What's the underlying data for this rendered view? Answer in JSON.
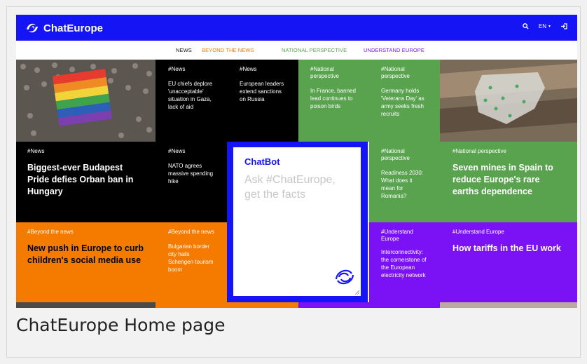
{
  "app": {
    "name": "ChatEurope"
  },
  "header": {
    "language": "EN",
    "search_icon": "search-icon",
    "login_icon": "sign-in-icon"
  },
  "nav": {
    "news": "NEWS",
    "beyond": "BEYOND THE NEWS",
    "national": "NATIONAL PERSPECTIVE",
    "understand": "UNDERSTAND EUROPE"
  },
  "tiles": {
    "t1": {
      "tag": "#News",
      "text": "EU chiefs deplore 'unacceptable' situation in Gaza, lack of aid"
    },
    "t2": {
      "tag": "#News",
      "text": "European leaders extend sanctions on Russia"
    },
    "t3": {
      "tag": "#National perspective",
      "text": "In France, banned lead continues to poison birds"
    },
    "t4": {
      "tag": "#National perspective",
      "text": "Germany holds 'Veterans Day' as army seeks fresh recruits"
    },
    "t5": {
      "tag": "#News",
      "title": "Biggest-ever Budapest Pride defies Orban ban in Hungary"
    },
    "t6": {
      "tag": "#News",
      "text": "NATO agrees massive spending hike"
    },
    "t7": {
      "tag": "#National perspective",
      "text": "Readiness 2030: What does it mean for Romania?"
    },
    "t8": {
      "tag": "#National perspective",
      "title": "Seven mines in Spain to reduce Europe's rare earths dependence"
    },
    "t9": {
      "tag": "#Beyond the news",
      "title": "New push in Europe to curb children's social media use"
    },
    "t10": {
      "tag": "#Beyond the news",
      "text": "Bulgarian border city hails Schengen tourism boom"
    },
    "t11": {
      "tag": "#Understand Europe",
      "text": "Interconnectivity: the cornerstone of the European electricity network"
    },
    "t12": {
      "tag": "#Understand Europe",
      "title": "How tariffs in the EU work"
    }
  },
  "chatbot": {
    "title": "ChatBot",
    "prompt": "Ask #ChatEurope, get the facts"
  },
  "caption": "ChatEurope Home page",
  "colors": {
    "brand_blue": "#1414f5",
    "news_black": "#000000",
    "national_green": "#59a34f",
    "beyond_orange": "#f47a00",
    "understand_purple": "#7b12f5"
  }
}
